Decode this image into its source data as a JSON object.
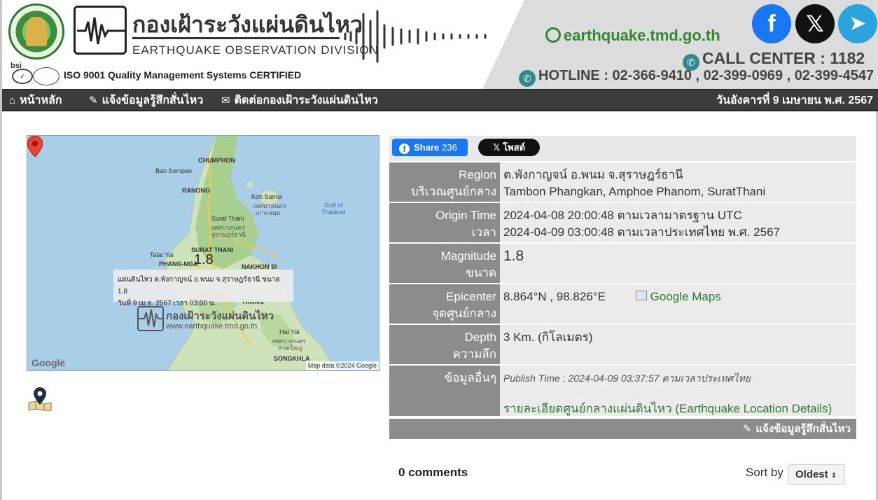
{
  "header": {
    "org_th": "กองเฝ้าระวังแผ่นดินไหว",
    "org_en": "EARTHQUAKE OBSERVATION DIVISION",
    "iso": "ISO 9001 Quality Management Systems CERTIFIED",
    "bsi": "bsi",
    "site": "earthquake.tmd.go.th",
    "call_center": "CALL CENTER : 1182",
    "hotline": "HOTLINE : 02-366-9410 , 02-399-0969 , 02-399-4547",
    "social": {
      "facebook": "f",
      "x": "𝕏",
      "telegram": "➤"
    }
  },
  "nav": {
    "items": [
      "หน้าหลัก",
      "แจ้งข้อมูลรู้สึกสั่นไหว",
      "ติดต่อกองเฝ้าระวังแผ่นดินไหว"
    ],
    "date": "วันอังคารที่ 9 เมษายน พ.ศ. 2567"
  },
  "map": {
    "labels": {
      "chumphon": "CHUMPHON",
      "ban_sompan": "Ban Sompan",
      "ranong": "RANONG",
      "koh_samui": "Koh Samui",
      "koh_samui_th1": "เทศบาลนคร",
      "koh_samui_th2": "เกาะสมุย",
      "gulf": "Gulf of\nThailand",
      "surat_thani": "Surat Thani",
      "surat_th1": "เทศบาลนคร",
      "surat_th2": "สุราษฎร์ธานี",
      "talat_yai": "Talat Yai",
      "phang_nga": "PHANG-NGA",
      "surat_thani_caps": "SURAT THANI",
      "nakhon_si": "NAKHON SI",
      "trang": "TRANG",
      "hat_yai": "Hat Yai",
      "hat_yai_th1": "เทศบาลนคร",
      "hat_yai_th2": "หาดใหญ่",
      "songkhla": "SONGKHLA"
    },
    "magnitude": "1.8",
    "caption_line1": "แผ่นดินไหว ต.พังกาญจน์ อ.พนม จ.สุราษฎร์ธานี ขนาด 1.8",
    "caption_line2": "วันที่ 9 เม.ย. 2567 เวลา 03:00 น.",
    "watermark_th": "กองเฝ้าระวังแผ่นดินไหว",
    "watermark_url": "www.earthquake.tmd.go.th",
    "google": "Google",
    "map_data": "Map data ©2024 Google"
  },
  "share": {
    "facebook_label": "Share",
    "facebook_count": "236",
    "x_label": "โพสต์"
  },
  "details": {
    "region_label_en": "Region",
    "region_label_th": "บริเวณศูนย์กลาง",
    "region_th": "ต.พังกาญจน์ อ.พนม จ.สุราษฎร์ธานี",
    "region_en": "Tambon Phangkan, Amphoe Phanom, SuratThani",
    "origin_label_en": "Origin Time",
    "origin_label_th": "เวลา",
    "origin_utc": "2024-04-08 20:00:48 ตามเวลามาตรฐาน UTC",
    "origin_local": "2024-04-09 03:00:48 ตามเวลาประเทศไทย พ.ศ. 2567",
    "magnitude_label_en": "Magnitude",
    "magnitude_label_th": "ขนาด",
    "magnitude": "1.8",
    "epicenter_label_en": "Epicenter",
    "epicenter_label_th": "จุดศูนย์กลาง",
    "epicenter": "8.864°N , 98.826°E",
    "google_maps": "Google Maps",
    "depth_label_en": "Depth",
    "depth_label_th": "ความลึก",
    "depth": "3 Km. (กิโลเมตร)",
    "other_label": "ข้อมูลอื่นๆ",
    "publish_time": "Publish Time : 2024-04-09 03:37:57 ตามเวลาประเทศไทย",
    "details_link": "รายละเอียดศูนย์กลางแผ่นดินไหว (Earthquake Location Details)",
    "report_felt": "แจ้งข้อมูลรู้สึกสั่นไหว"
  },
  "comments": {
    "count_label": "0 comments",
    "sort_label": "Sort by",
    "sort_value": "Oldest"
  },
  "colors": {
    "nav_bg": "#3c3c3c",
    "label_bg": "#8c8c8c",
    "value_bg": "#ebebeb",
    "link_green": "#2f7a2f",
    "facebook": "#1877f2"
  }
}
